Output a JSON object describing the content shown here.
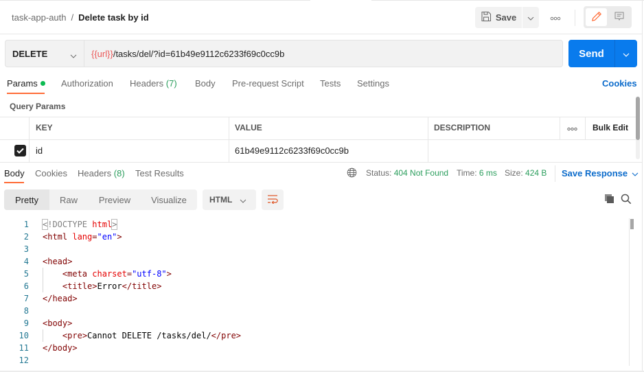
{
  "header": {
    "collection": "task-app-auth",
    "separator": "/",
    "request_name": "Delete task by id",
    "save_label": "Save",
    "more_icon": "ellipsis-icon",
    "modes": [
      "edit-pencil-icon",
      "comment-icon"
    ]
  },
  "request": {
    "method": "DELETE",
    "url_variable": "{{url}}",
    "url_path": "/tasks/del/?id=61b49e9112c6233f69c0cc9b",
    "send_label": "Send"
  },
  "request_tabs": [
    {
      "label": "Params",
      "active": true,
      "indicator": "green-dot"
    },
    {
      "label": "Authorization"
    },
    {
      "label": "Headers",
      "count": "(7)"
    },
    {
      "label": "Body"
    },
    {
      "label": "Pre-request Script"
    },
    {
      "label": "Tests"
    },
    {
      "label": "Settings"
    }
  ],
  "cookies_link": "Cookies",
  "query_params": {
    "title": "Query Params",
    "columns": [
      "KEY",
      "VALUE",
      "DESCRIPTION"
    ],
    "bulk_edit": "Bulk Edit",
    "rows": [
      {
        "checked": true,
        "key": "id",
        "value": "61b49e9112c6233f69c0cc9b",
        "description": ""
      }
    ]
  },
  "response_tabs": [
    {
      "label": "Body",
      "active": true
    },
    {
      "label": "Cookies"
    },
    {
      "label": "Headers",
      "count": "(8)"
    },
    {
      "label": "Test Results"
    }
  ],
  "response_meta": {
    "status_label": "Status:",
    "status_value": "404 Not Found",
    "time_label": "Time:",
    "time_value": "6 ms",
    "size_label": "Size:",
    "size_value": "424 B",
    "save_response": "Save Response",
    "colors": {
      "success_text": "#2a9d5c",
      "link": "#0b6bcb",
      "accent": "#ff6c37",
      "send": "#097bed"
    }
  },
  "view_modes": [
    "Pretty",
    "Raw",
    "Preview",
    "Visualize"
  ],
  "active_view": "Pretty",
  "format": "HTML",
  "code_lines": [
    {
      "n": "1",
      "text": "<!DOCTYPE html>"
    },
    {
      "n": "2",
      "text": "<html lang=\"en\">"
    },
    {
      "n": "3",
      "text": ""
    },
    {
      "n": "4",
      "text": "<head>"
    },
    {
      "n": "5",
      "text": "    <meta charset=\"utf-8\">"
    },
    {
      "n": "6",
      "text": "    <title>Error</title>"
    },
    {
      "n": "7",
      "text": "</head>"
    },
    {
      "n": "8",
      "text": ""
    },
    {
      "n": "9",
      "text": "<body>"
    },
    {
      "n": "10",
      "text": "    <pre>Cannot DELETE /tasks/del/</pre>"
    },
    {
      "n": "11",
      "text": "</body>"
    },
    {
      "n": "12",
      "text": ""
    }
  ]
}
